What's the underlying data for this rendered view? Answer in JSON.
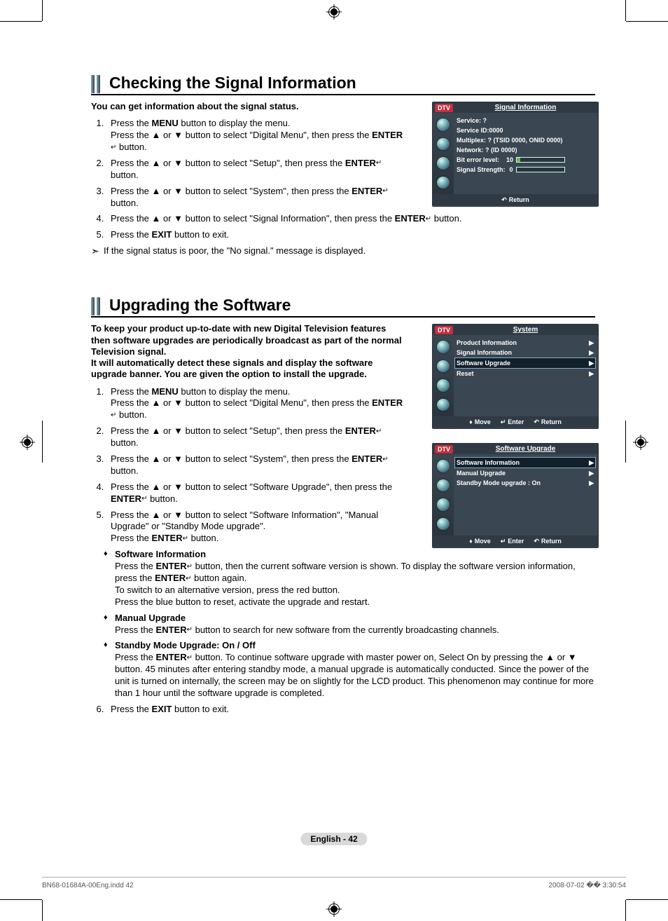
{
  "section1": {
    "heading": "Checking the Signal Information",
    "intro": "You can get information about the signal status.",
    "steps": {
      "s1a": "Press the ",
      "s1b": " button to display the menu.",
      "s1c": "Press the ▲ or ▼ button to select \"Digital Menu\", then press the ",
      "s1d": " button.",
      "s2a": "Press the ▲ or ▼ button to select \"Setup\", then press the ",
      "s3a": "Press the ▲ or ▼ button to select \"System\", then press the ",
      "s4a": "Press the ▲ or ▼ button to select \"Signal Information\", then press the ",
      "s5a": "Press the ",
      "s5b": " button to exit."
    },
    "menu": "MENU",
    "enter": "ENTER",
    "exit": "EXIT",
    "note": "If the signal status is poor, the \"No signal.\" message is displayed."
  },
  "section2": {
    "heading": "Upgrading the Software",
    "intro": "To keep your product up-to-date with new Digital Television features then software upgrades are periodically broadcast as part of the normal Television signal.\nIt will automatically detect these signals and display the software upgrade banner. You are given the option to install the upgrade.",
    "steps": {
      "s4a": "Press the ▲ or ▼ button to select \"Software Upgrade\", then press the ",
      "s5a": "Press the ▲ or ▼ button to select \"Software Information\", \"Manual Upgrade\" or \"Standby Mode upgrade\".",
      "s5b": "Press the "
    },
    "sub": {
      "si_title": "Software Information",
      "si_body1": "Press the ",
      "si_body2": " button, then the current software version is shown. To display the software version information, press the ",
      "si_body3": " button again.",
      "si_body4": "To switch to an alternative version, press the red button.",
      "si_body5": "Press the blue button to reset, activate the upgrade and restart.",
      "mu_title": "Manual Upgrade",
      "mu_body1": "Press the ",
      "mu_body2": " button to search for new software from the currently broadcasting channels.",
      "sm_title": "Standby Mode Upgrade: On / Off",
      "sm_body1": "Press the ",
      "sm_body2": " button. To continue software upgrade with master power on, Select On by pressing the ▲ or ▼ button. 45 minutes after entering standby mode, a manual upgrade is automatically conducted. Since the power of the unit is turned on internally, the screen may be on slightly for the LCD product. This phenomenon may continue for more than 1 hour until the software upgrade is completed."
    }
  },
  "osd1": {
    "dtv": "DTV",
    "title": "Signal Information",
    "lines": {
      "l1": "Service: ?",
      "l2": "Service ID:0000",
      "l3": "Multiplex: ? (TSID 0000, ONID 0000)",
      "l4": "Network: ? (ID 0000)",
      "l5": "Bit error level:",
      "l5v": "10",
      "l6": "Signal Strength:",
      "l6v": "0"
    },
    "return": "Return"
  },
  "osd2": {
    "dtv": "DTV",
    "title": "System",
    "items": {
      "i1": "Product Information",
      "i2": "Signal Information",
      "i3": "Software Upgrade",
      "i4": "Reset"
    },
    "move": "Move",
    "enter": "Enter",
    "return": "Return"
  },
  "osd3": {
    "dtv": "DTV",
    "title": "Software Upgrade",
    "items": {
      "i1": "Software Information",
      "i2": "Manual Upgrade",
      "i3": "Standby Mode upgrade : On"
    },
    "move": "Move",
    "enter": "Enter",
    "return": "Return"
  },
  "pagebadge": "English - 42",
  "footer": {
    "left": "BN68-01684A-00Eng.indd   42",
    "right": "2008-07-02   �� 3:30:54"
  },
  "glyphs": {
    "enter": "↵",
    "chevron": "▶",
    "returnArrow": "↶",
    "updown": "♦"
  }
}
